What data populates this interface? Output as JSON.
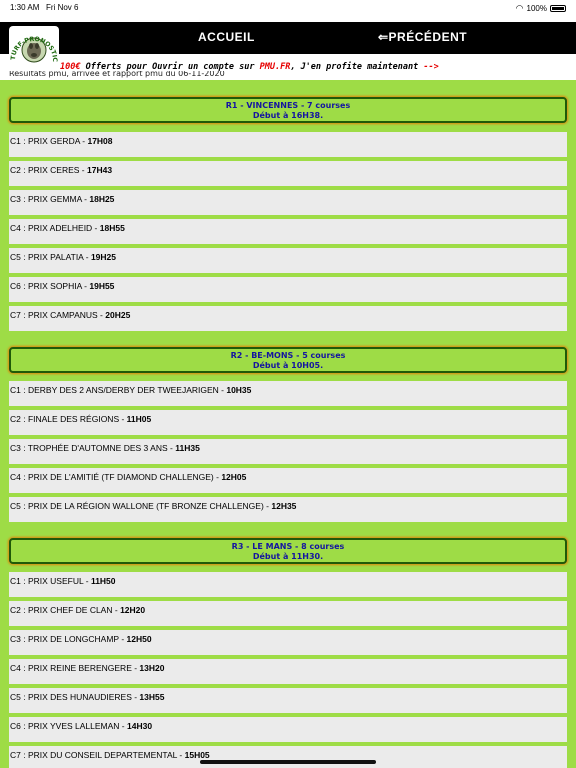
{
  "status": {
    "time": "1:30 AM",
    "date": "Fri Nov 6",
    "battery": "100%"
  },
  "nav": {
    "home": "ACCUEIL",
    "back": "⇐PRÉCÉDENT"
  },
  "logo": {
    "text": "TURF-PRONOSTICS"
  },
  "promo": {
    "amount": "100€",
    "text1": " Offerts pour Ouvrir un compte sur ",
    "site": "PMU.FR",
    "text2": ", J'en profite maintenant ",
    "arrow": "-->"
  },
  "subtitle": "Résultats pmu, arrivée et rapport pmu du 06-11-2020",
  "reunions": [
    {
      "title": "R1 - VINCENNES - 7 courses",
      "start": "Début à 16H38.",
      "courses": [
        {
          "label": "C1 : PRIX GERDA - ",
          "time": "17H08"
        },
        {
          "label": "C2 : PRIX CERES - ",
          "time": "17H43"
        },
        {
          "label": "C3 : PRIX GEMMA - ",
          "time": "18H25"
        },
        {
          "label": "C4 : PRIX ADELHEID - ",
          "time": "18H55"
        },
        {
          "label": "C5 : PRIX PALATIA - ",
          "time": "19H25"
        },
        {
          "label": "C6 : PRIX SOPHIA - ",
          "time": "19H55"
        },
        {
          "label": "C7 : PRIX CAMPANUS - ",
          "time": "20H25"
        }
      ]
    },
    {
      "title": "R2 - BE-MONS - 5 courses",
      "start": "Début à 10H05.",
      "courses": [
        {
          "label": "C1 : DERBY DES 2 ANS/DERBY DER TWEEJARIGEN - ",
          "time": "10H35"
        },
        {
          "label": "C2 : FINALE DES RÉGIONS - ",
          "time": "11H05"
        },
        {
          "label": "C3 : TROPHÉE D'AUTOMNE DES 3 ANS - ",
          "time": "11H35"
        },
        {
          "label": "C4 : PRIX DE L'AMITIÉ (TF DIAMOND CHALLENGE) - ",
          "time": "12H05"
        },
        {
          "label": "C5 : PRIX DE LA RÉGION WALLONE (TF BRONZE CHALLENGE) - ",
          "time": "12H35"
        }
      ]
    },
    {
      "title": "R3 - LE MANS - 8 courses",
      "start": "Début à 11H30.",
      "courses": [
        {
          "label": "C1 : PRIX USEFUL - ",
          "time": "11H50"
        },
        {
          "label": "C2 : PRIX CHEF DE CLAN - ",
          "time": "12H20"
        },
        {
          "label": "C3 : PRIX DE LONGCHAMP - ",
          "time": "12H50"
        },
        {
          "label": "C4 : PRIX REINE BERENGERE - ",
          "time": "13H20"
        },
        {
          "label": "C5 : PRIX DES HUNAUDIERES - ",
          "time": "13H55"
        },
        {
          "label": "C6 : PRIX YVES LALLEMAN - ",
          "time": "14H30"
        },
        {
          "label": "C7 : PRIX DU CONSEIL DEPARTEMENTAL - ",
          "time": "15H05"
        }
      ]
    }
  ]
}
